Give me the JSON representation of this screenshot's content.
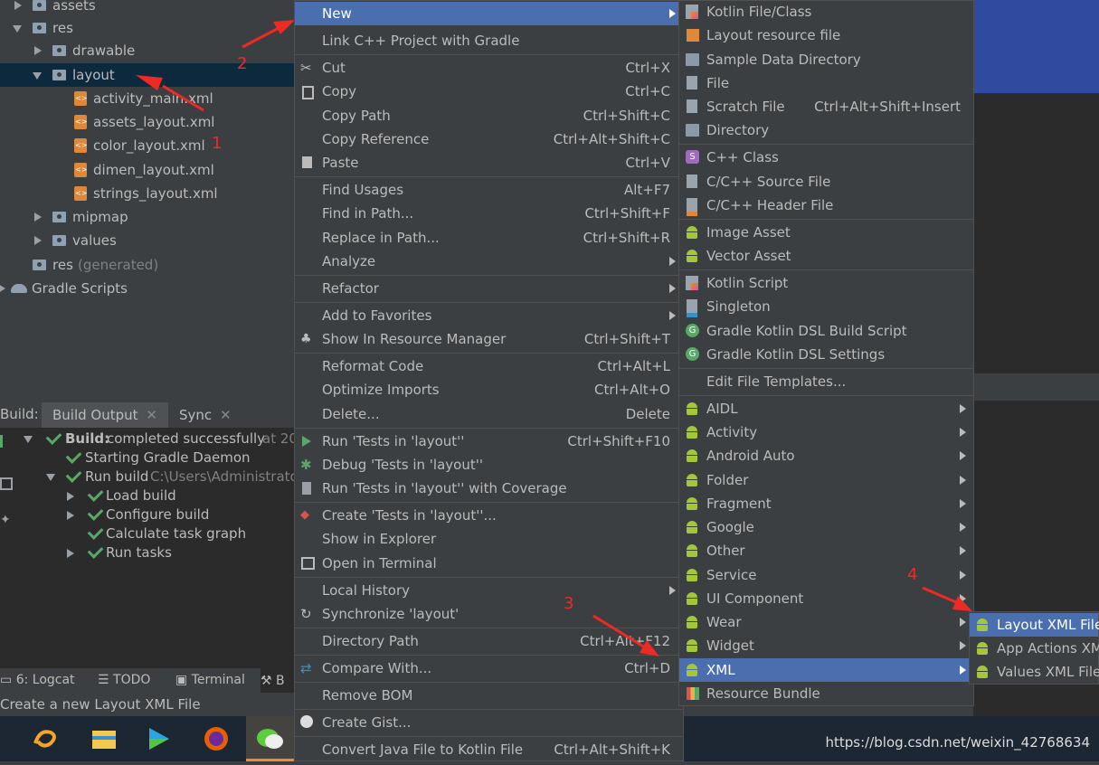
{
  "tree": {
    "items": [
      {
        "label": "assets"
      },
      {
        "label": "res"
      },
      {
        "label": "drawable"
      },
      {
        "label": "layout"
      },
      {
        "label": "activity_main.xml"
      },
      {
        "label": "assets_layout.xml"
      },
      {
        "label": "color_layout.xml"
      },
      {
        "label": "dimen_layout.xml"
      },
      {
        "label": "strings_layout.xml"
      },
      {
        "label": "mipmap"
      },
      {
        "label": "values"
      },
      {
        "label": "res",
        "suffix": "(generated)"
      },
      {
        "label": "Gradle Scripts"
      }
    ]
  },
  "annotations": {
    "a1": "1",
    "a2": "2",
    "a3": "3",
    "a4": "4"
  },
  "build": {
    "tab_prefix": "Build:",
    "tabs": [
      "Build Output",
      "Sync"
    ],
    "rows": [
      {
        "bold": "Build:",
        "text": "completed successfully",
        "suffix": "at 20"
      },
      {
        "text": "Starting Gradle Daemon"
      },
      {
        "text": "Run build",
        "suffix": "C:\\Users\\Administrato"
      },
      {
        "text": "Load build"
      },
      {
        "text": "Configure build"
      },
      {
        "text": "Calculate task graph"
      },
      {
        "text": "Run tasks"
      }
    ]
  },
  "bottom_tabs": [
    "6: Logcat",
    "TODO",
    "Terminal",
    "B"
  ],
  "status": "Create a new Layout XML File",
  "watermark": "https://blog.csdn.net/weixin_42768634",
  "main_menu": [
    {
      "label": "New",
      "sc": "",
      "sub": true
    },
    {
      "label": "Link C++ Project with Gradle",
      "sc": ""
    },
    {
      "label": "Cut",
      "sc": "Ctrl+X"
    },
    {
      "label": "Copy",
      "sc": "Ctrl+C"
    },
    {
      "label": "Copy Path",
      "sc": "Ctrl+Shift+C"
    },
    {
      "label": "Copy Reference",
      "sc": "Ctrl+Alt+Shift+C"
    },
    {
      "label": "Paste",
      "sc": "Ctrl+V"
    },
    {
      "label": "Find Usages",
      "sc": "Alt+F7"
    },
    {
      "label": "Find in Path...",
      "sc": "Ctrl+Shift+F"
    },
    {
      "label": "Replace in Path...",
      "sc": "Ctrl+Shift+R"
    },
    {
      "label": "Analyze",
      "sc": "",
      "sub": true
    },
    {
      "label": "Refactor",
      "sc": "",
      "sub": true
    },
    {
      "label": "Add to Favorites",
      "sc": "",
      "sub": true
    },
    {
      "label": "Show In Resource Manager",
      "sc": "Ctrl+Shift+T"
    },
    {
      "label": "Reformat Code",
      "sc": "Ctrl+Alt+L"
    },
    {
      "label": "Optimize Imports",
      "sc": "Ctrl+Alt+O"
    },
    {
      "label": "Delete...",
      "sc": "Delete"
    },
    {
      "label": "Run 'Tests in 'layout''",
      "sc": "Ctrl+Shift+F10"
    },
    {
      "label": "Debug 'Tests in 'layout''",
      "sc": ""
    },
    {
      "label": "Run 'Tests in 'layout'' with Coverage",
      "sc": ""
    },
    {
      "label": "Create 'Tests in 'layout''...",
      "sc": ""
    },
    {
      "label": "Show in Explorer",
      "sc": ""
    },
    {
      "label": "Open in Terminal",
      "sc": ""
    },
    {
      "label": "Local History",
      "sc": "",
      "sub": true
    },
    {
      "label": "Synchronize 'layout'",
      "sc": ""
    },
    {
      "label": "Directory Path",
      "sc": "Ctrl+Alt+F12"
    },
    {
      "label": "Compare With...",
      "sc": "Ctrl+D"
    },
    {
      "label": "Remove BOM",
      "sc": ""
    },
    {
      "label": "Create Gist...",
      "sc": ""
    },
    {
      "label": "Convert Java File to Kotlin File",
      "sc": "Ctrl+Alt+Shift+K"
    }
  ],
  "new_menu": [
    {
      "label": "Kotlin File/Class",
      "sc": ""
    },
    {
      "label": "Layout resource file",
      "sc": ""
    },
    {
      "label": "Sample Data Directory",
      "sc": ""
    },
    {
      "label": "File",
      "sc": ""
    },
    {
      "label": "Scratch File",
      "sc": "Ctrl+Alt+Shift+Insert"
    },
    {
      "label": "Directory",
      "sc": ""
    },
    {
      "label": "C++ Class",
      "sc": ""
    },
    {
      "label": "C/C++ Source File",
      "sc": ""
    },
    {
      "label": "C/C++ Header File",
      "sc": ""
    },
    {
      "label": "Image Asset",
      "sc": ""
    },
    {
      "label": "Vector Asset",
      "sc": ""
    },
    {
      "label": "Kotlin Script",
      "sc": ""
    },
    {
      "label": "Singleton",
      "sc": ""
    },
    {
      "label": "Gradle Kotlin DSL Build Script",
      "sc": ""
    },
    {
      "label": "Gradle Kotlin DSL Settings",
      "sc": ""
    },
    {
      "label": "Edit File Templates...",
      "sc": ""
    },
    {
      "label": "AIDL",
      "sub": true
    },
    {
      "label": "Activity",
      "sub": true
    },
    {
      "label": "Android Auto",
      "sub": true
    },
    {
      "label": "Folder",
      "sub": true
    },
    {
      "label": "Fragment",
      "sub": true
    },
    {
      "label": "Google",
      "sub": true
    },
    {
      "label": "Other",
      "sub": true
    },
    {
      "label": "Service",
      "sub": true
    },
    {
      "label": "UI Component",
      "sub": true
    },
    {
      "label": "Wear",
      "sub": true
    },
    {
      "label": "Widget",
      "sub": true
    },
    {
      "label": "XML",
      "sub": true
    },
    {
      "label": "Resource Bundle"
    }
  ],
  "xml_menu": [
    {
      "label": "Layout XML File"
    },
    {
      "label": "App Actions XM"
    },
    {
      "label": "Values XML File"
    }
  ]
}
